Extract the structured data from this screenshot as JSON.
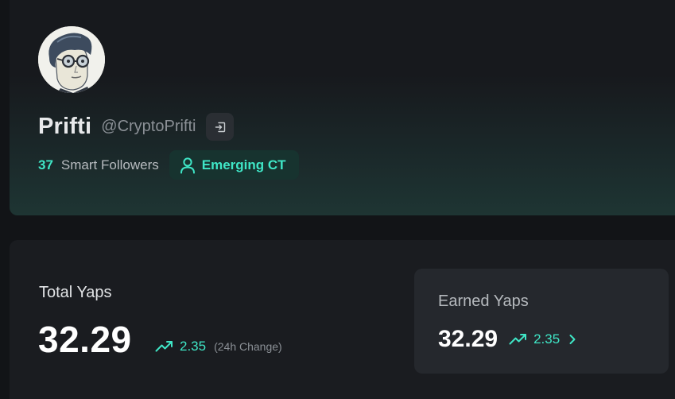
{
  "profile": {
    "display_name": "Prifti",
    "handle": "@CryptoPrifti",
    "smart_followers_count": "37",
    "smart_followers_label": "Smart Followers",
    "tier": "Emerging CT",
    "accent_color": "#3fe6c6"
  },
  "stats": {
    "total_title": "Total Yaps",
    "total_value": "32.29",
    "total_change": "2.35",
    "total_change_note": "(24h Change)",
    "earned_title": "Earned Yaps",
    "earned_value": "32.29",
    "earned_change": "2.35"
  },
  "icons": {
    "avatar": "avatar-illustration",
    "login": "login-icon",
    "tier": "user-icon",
    "trend": "trending-up-icon",
    "chevron": "chevron-right-icon"
  }
}
